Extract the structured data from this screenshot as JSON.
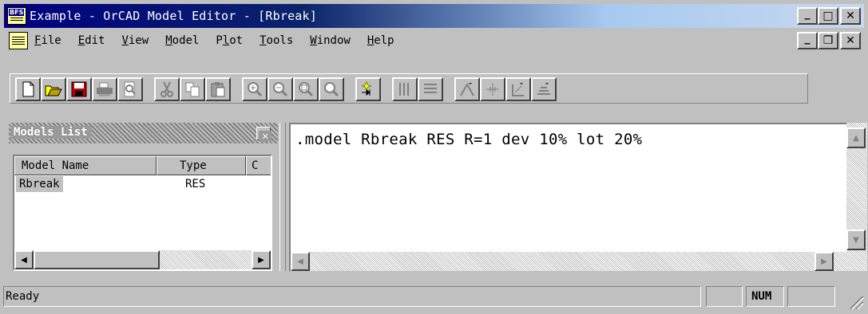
{
  "window": {
    "title": "Example - OrCAD Model Editor - [Rbreak]",
    "app_icon_label": "BFS",
    "minimize": "_",
    "maximize": "□",
    "close": "✕"
  },
  "mdi": {
    "minimize": "_",
    "restore": "❐",
    "close": "✕"
  },
  "menu": [
    {
      "key": "F",
      "rest": "ile"
    },
    {
      "key": "E",
      "rest": "dit"
    },
    {
      "key": "V",
      "rest": "iew"
    },
    {
      "key": "M",
      "rest": "odel"
    },
    {
      "key": "P",
      "rest": "lot",
      "pre": ""
    },
    {
      "key": "T",
      "rest": "ools"
    },
    {
      "key": "W",
      "rest": "indow"
    },
    {
      "key": "H",
      "rest": "elp"
    }
  ],
  "menu_labels": {
    "file": "File",
    "edit": "Edit",
    "view": "View",
    "model": "Model",
    "plot": "Plot",
    "tools": "Tools",
    "window": "Window",
    "help": "Help"
  },
  "toolbar": {
    "icons": [
      "new-icon",
      "open-icon",
      "save-icon",
      "print-icon",
      "print-preview-icon",
      "cut-icon",
      "copy-icon",
      "paste-icon",
      "zoom-in-icon",
      "zoom-out-icon",
      "zoom-area-icon",
      "zoom-fit-icon",
      "add-marker-icon",
      "tile-vertical-icon",
      "tile-horizontal-icon",
      "model-extract-icon",
      "model-add-icon",
      "model-new-icon",
      "model-import-icon"
    ]
  },
  "models_panel": {
    "title": "Models List",
    "close": "✕",
    "columns": [
      "Model Name",
      "Type",
      "C"
    ],
    "rows": [
      {
        "name": "Rbreak",
        "type": "RES"
      }
    ]
  },
  "editor": {
    "text": ".model Rbreak RES R=1 dev 10% lot 20%"
  },
  "status": {
    "message": "Ready",
    "num": "NUM"
  },
  "colors": {
    "title_start": "#000080",
    "face": "#c0c0c0",
    "save_red": "#c00000"
  }
}
